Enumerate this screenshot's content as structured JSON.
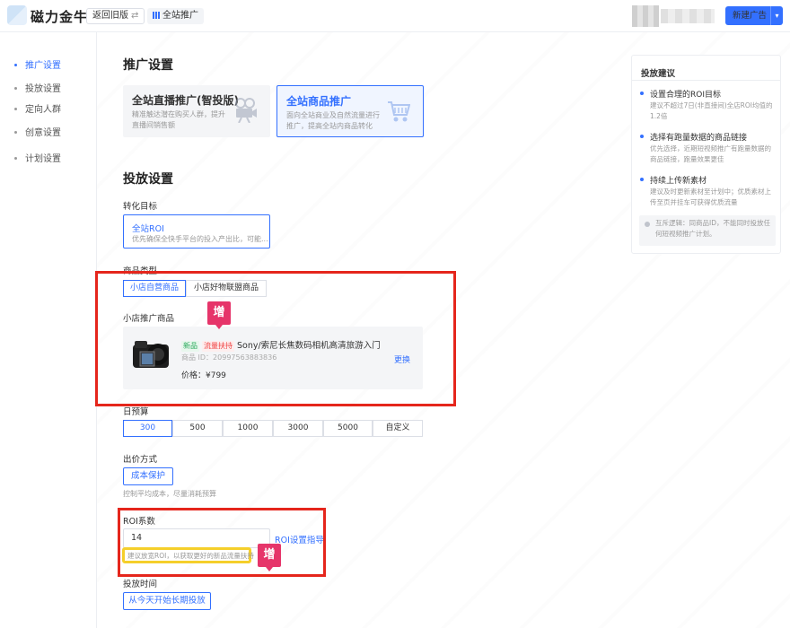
{
  "header": {
    "app_name": "磁力金牛",
    "back_button": "返回旧版",
    "back_switch_icon": "⇄",
    "site_tag": "全站推广",
    "new_button": "新建广告",
    "new_button_arrow": "▾"
  },
  "sidebar": {
    "items": [
      {
        "label": "推广设置",
        "active": true
      },
      {
        "label": "投放设置",
        "active": false
      },
      {
        "label": "定向人群",
        "active": false
      },
      {
        "label": "创意设置",
        "active": false
      },
      {
        "label": "计划设置",
        "active": false
      }
    ]
  },
  "promo": {
    "title": "推广设置",
    "cards": [
      {
        "title": "全站直播推广(智投版)",
        "desc": "精准触达潜在购买人群，提升直播间销售额",
        "icon": "camera-icon",
        "selected": false
      },
      {
        "title": "全站商品推广",
        "desc": "面向全站商业及自然流量进行推广，提高全站内商品转化",
        "icon": "cart-icon",
        "selected": true
      }
    ]
  },
  "delivery": {
    "title": "投放设置",
    "goal_label": "转化目标",
    "goal_title": "全站ROI",
    "goal_desc": "优先确保全快手平台的投入产出比，可能...",
    "goods_type_label": "商品类型",
    "goods_types": [
      "小店自营商品",
      "小店好物联盟商品"
    ],
    "product_label": "小店推广商品",
    "product": {
      "tag_new": "新品",
      "tag_flow": "流量扶持",
      "name": "Sony/索尼长焦数码相机高清旅游入门",
      "id": "商品 ID：20997563883836",
      "price": "价格：¥799",
      "swap": "更换"
    },
    "budget_label": "日预算",
    "budgets": [
      "300",
      "500",
      "1000",
      "3000",
      "5000",
      "自定义"
    ],
    "bid_label": "出价方式",
    "bid_button": "成本保护",
    "bid_hint": "控制平均成本，尽量消耗预算",
    "roi_label": "ROI系数",
    "roi_value": "14",
    "roi_link": "ROI设置指导",
    "roi_hint": "建议放宽ROI，以获取更好的新品流量扶持",
    "time_label": "投放时间",
    "time_button": "从今天开始长期投放"
  },
  "annotations": {
    "zeng": "增"
  },
  "tips": {
    "title": "投放建议",
    "items": [
      {
        "title": "设置合理的ROI目标",
        "desc": "建议不超过7日(非直接间)全店ROI均值的1.2倍"
      },
      {
        "title": "选择有跑量数据的商品链接",
        "desc": "优先选择，近期短视频推广有跑量数据的商品链接，跑量效果更佳"
      },
      {
        "title": "持续上传新素材",
        "desc": "建议及时更新素材至计划中；优质素材上传至页并挂车可获得优质流量"
      }
    ],
    "note": "互斥逻辑：同商品ID，不能同时投放任何短视频推广计划。"
  }
}
